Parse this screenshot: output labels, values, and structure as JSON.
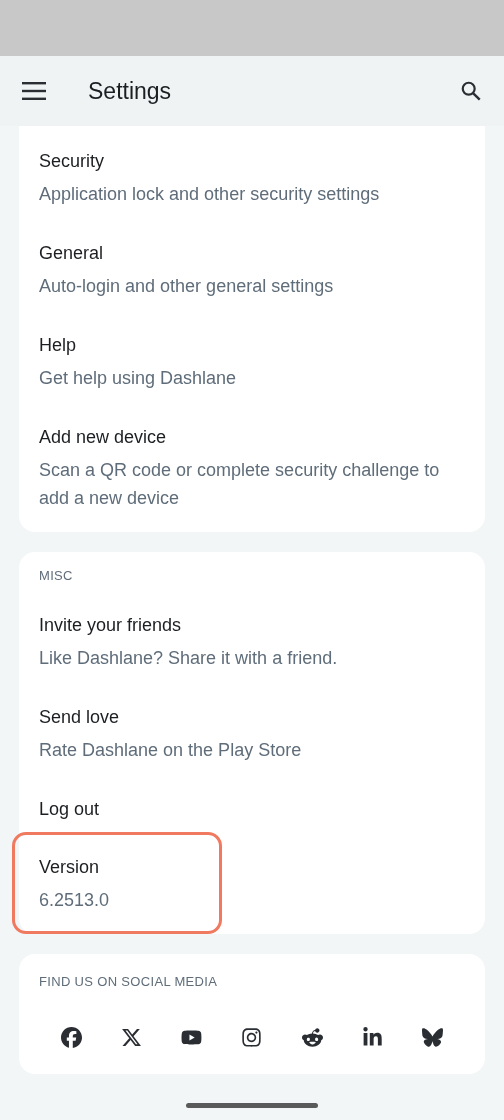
{
  "app_bar": {
    "title": "Settings"
  },
  "sections": [
    {
      "items": [
        {
          "title": "Security",
          "subtitle": "Application lock and other security settings",
          "highlighted": false
        },
        {
          "title": "General",
          "subtitle": "Auto-login and other general settings",
          "highlighted": false
        },
        {
          "title": "Help",
          "subtitle": "Get help using Dashlane",
          "highlighted": false
        },
        {
          "title": "Add new device",
          "subtitle": "Scan a QR code or complete security challenge to add a new device",
          "highlighted": false
        }
      ]
    },
    {
      "header": "MISC",
      "items": [
        {
          "title": "Invite your friends",
          "subtitle": "Like Dashlane? Share it with a friend.",
          "highlighted": false
        },
        {
          "title": "Send love",
          "subtitle": "Rate Dashlane on the Play Store",
          "highlighted": false
        },
        {
          "title": "Log out",
          "highlighted": false
        },
        {
          "title": "Version",
          "subtitle": "6.2513.0",
          "highlighted": true
        }
      ]
    }
  ],
  "social": {
    "header": "FIND US ON SOCIAL MEDIA"
  }
}
